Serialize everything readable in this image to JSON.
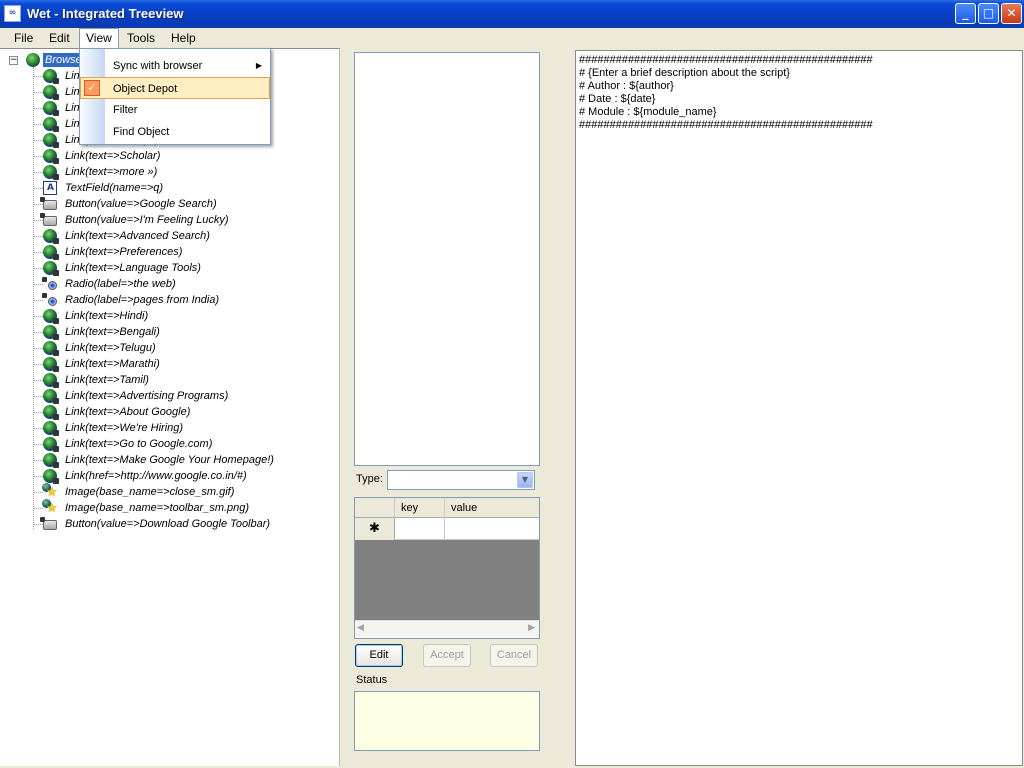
{
  "window": {
    "title": "Wet - Integrated Treeview",
    "app_icon_text": "∞",
    "controls": {
      "minimize": "_",
      "maximize": "□",
      "close": "✕"
    }
  },
  "menubar": {
    "items": [
      {
        "label": "File"
      },
      {
        "label": "Edit"
      },
      {
        "label": "View"
      },
      {
        "label": "Tools"
      },
      {
        "label": "Help"
      }
    ]
  },
  "view_menu": {
    "items": [
      {
        "label": "Sync with browser",
        "has_submenu": true,
        "submenu_arrow": "▶"
      },
      {
        "label": "Object Depot",
        "checked": true,
        "check_glyph": "✓"
      },
      {
        "label": "Filter"
      },
      {
        "label": "Find Object"
      }
    ]
  },
  "tree": {
    "root_label": "Browser",
    "root_toggle": "−",
    "items": [
      {
        "icon": "link",
        "label": "Link(text=>Web)"
      },
      {
        "icon": "link",
        "label": "Link(text=>Images)"
      },
      {
        "icon": "link",
        "label": "Link(text=>News)"
      },
      {
        "icon": "link",
        "label": "Link(text=>Orkut)"
      },
      {
        "icon": "link",
        "label": "Link(text=>Groups)"
      },
      {
        "icon": "link",
        "label": "Link(text=>Scholar)"
      },
      {
        "icon": "link",
        "label": "Link(text=>more »)"
      },
      {
        "icon": "textfield",
        "label": "TextField(name=>q)"
      },
      {
        "icon": "button",
        "label": "Button(value=>Google Search)"
      },
      {
        "icon": "button",
        "label": "Button(value=>I'm Feeling Lucky)"
      },
      {
        "icon": "link",
        "label": "Link(text=>Advanced Search)"
      },
      {
        "icon": "link",
        "label": "Link(text=>Preferences)"
      },
      {
        "icon": "link",
        "label": "Link(text=>Language Tools)"
      },
      {
        "icon": "radio",
        "label": "Radio(label=>the web)"
      },
      {
        "icon": "radio",
        "label": "Radio(label=>pages from India)"
      },
      {
        "icon": "link",
        "label": "Link(text=>Hindi)"
      },
      {
        "icon": "link",
        "label": "Link(text=>Bengali)"
      },
      {
        "icon": "link",
        "label": "Link(text=>Telugu)"
      },
      {
        "icon": "link",
        "label": "Link(text=>Marathi)"
      },
      {
        "icon": "link",
        "label": "Link(text=>Tamil)"
      },
      {
        "icon": "link",
        "label": "Link(text=>Advertising Programs)"
      },
      {
        "icon": "link",
        "label": "Link(text=>About Google)"
      },
      {
        "icon": "link",
        "label": "Link(text=>We're Hiring)"
      },
      {
        "icon": "link",
        "label": "Link(text=>Go to Google.com)"
      },
      {
        "icon": "link",
        "label": "Link(text=>Make Google Your Homepage!)"
      },
      {
        "icon": "link",
        "label": "Link(href=>http://www.google.co.in/#)"
      },
      {
        "icon": "image",
        "label": "Image(base_name=>close_sm.gif)"
      },
      {
        "icon": "image",
        "label": "Image(base_name=>toolbar_sm.png)"
      },
      {
        "icon": "button",
        "label": "Button(value=>Download Google Toolbar)"
      }
    ]
  },
  "properties": {
    "type_label": "Type:",
    "type_value": "",
    "type_dropdown_glyph": "▼",
    "grid": {
      "columns": [
        "key",
        "value"
      ],
      "new_row_glyph": "✱",
      "scroll_left": "◀",
      "scroll_right": "▶"
    },
    "buttons": {
      "edit": "Edit",
      "accept": "Accept",
      "cancel": "Cancel"
    },
    "status_label": "Status",
    "status_text": ""
  },
  "script": {
    "lines": [
      "################################################",
      "# {Enter a brief description about the script}",
      "# Author : ${author}",
      "# Date : ${date}",
      "# Module : ${module_name}",
      "################################################"
    ]
  }
}
